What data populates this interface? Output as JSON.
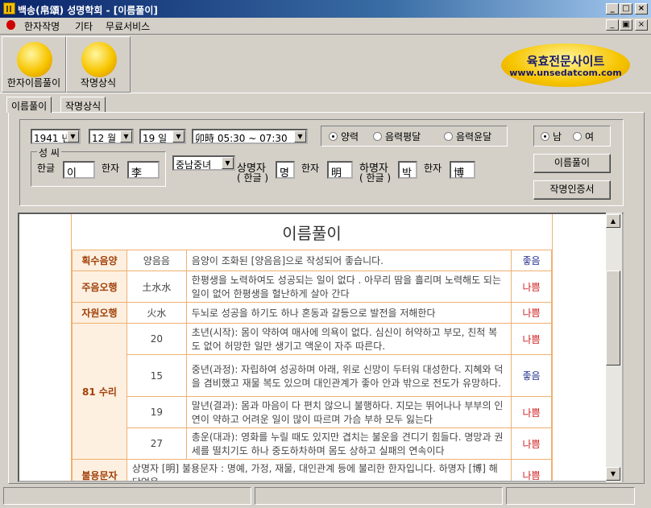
{
  "window": {
    "title": "백송(帛頌) 성명학회 - [이름풀이]"
  },
  "menu": [
    "한자작명",
    "기타",
    "무료서비스"
  ],
  "toolbar": [
    {
      "label": "한자이름풀이"
    },
    {
      "label": "작명상식"
    }
  ],
  "brand": {
    "line1": "육효전문사이트",
    "line2": "www.unsedatcom.com"
  },
  "tabs": [
    "이름풀이",
    "작명상식"
  ],
  "form": {
    "year": "1941 년",
    "month": "12 월",
    "day": "19 일",
    "time": "卯時 05:30 ~ 07:30",
    "calendar_options": [
      "양력",
      "음력평달",
      "음력윤달"
    ],
    "calendar_selected": 0,
    "gender_options": [
      "남",
      "여"
    ],
    "gender_selected": 0,
    "surname_group": "성 씨",
    "hangul_label": "한글",
    "hanja_label": "한자",
    "surname_hangul": "이",
    "surname_hanja": "李",
    "gender_combo": "중남중녀",
    "sang_label_1": "상명자",
    "sang_label_2": "( 한글 )",
    "sang_hangul": "명",
    "sang_hanja": "明",
    "ha_label_1": "하명자",
    "ha_label_2": "( 한글 )",
    "ha_hangul": "박",
    "ha_hanja": "博",
    "btn_interpret": "이름풀이",
    "btn_certificate": "작명인증서"
  },
  "result": {
    "title": "이름풀이",
    "rows": [
      {
        "cat": "획수음양",
        "mid": "양음음",
        "desc": "음양이 조화된 [양음음]으로 작성되어 좋습니다.",
        "rating": "좋음",
        "good": true
      },
      {
        "cat": "주음오행",
        "mid": "土水水",
        "desc": "한평생을 노력하여도 성공되는 일이 없다 . 아무리 땀을 흘리며 노력해도 되는 일이 없어 한평생을 헐난하게 살아 간다",
        "rating": "나쁨",
        "good": false
      },
      {
        "cat": "자원오행",
        "mid": "火水",
        "desc": "두뇌로 성공을 하기도 하나 혼동과 갈등으로 발전을 저해한다",
        "rating": "나쁨",
        "good": false
      }
    ],
    "suri_label": "81 수리",
    "suri": [
      {
        "num": "20",
        "desc": "초년(시작): 몸이 약하여 매사에 의욕이 없다. 심신이 허약하고 부모, 친척 복도 없어 허망한 일만 생기고 액운이 자주 따른다.",
        "rating": "나쁨",
        "good": false
      },
      {
        "num": "15",
        "desc": "중년(과정): 자립하여 성공하며 아래, 위로 신망이 두터워 대성한다. 지혜와 덕을 겸비했고 재물 복도 있으며 대인관계가 좋아 안과 밖으로 전도가 유망하다.",
        "rating": "좋음",
        "good": true
      },
      {
        "num": "19",
        "desc": "말년(결과): 몸과 마음이 다 편치 않으니 불행하다. 지모는 뛰어나나 부부의 인연이 약하고 어려운 일이 많이 따르며 가슴 부하 모두 잃는다",
        "rating": "나쁨",
        "good": false
      },
      {
        "num": "27",
        "desc": "총운(대과): 영화를 누릴 때도 있지만 겹치는 불운을 견디기 힘들다. 명망과 권세를 떨치기도 하나 중도하차하며 몸도 상하고 실패의 연속이다",
        "rating": "나쁨",
        "good": false
      }
    ],
    "bulyong": {
      "cat": "불용문자",
      "desc": "상명자 [明] 불용문자 : 명예, 가정, 재물, 대인관계 등에 불리한 한자입니다. 하명자 [博] 해당없음.",
      "rating": "나쁨"
    }
  }
}
